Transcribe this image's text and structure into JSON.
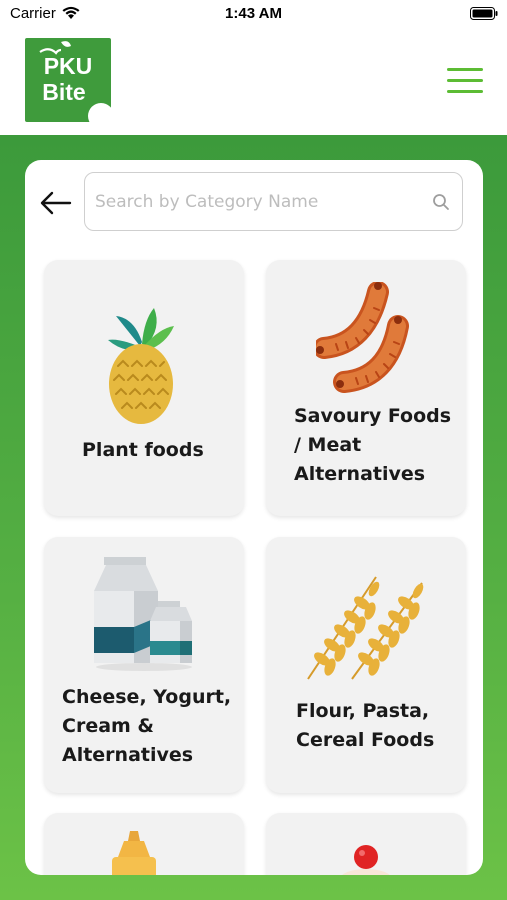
{
  "status_bar": {
    "carrier": "Carrier",
    "time": "1:43 AM"
  },
  "header": {
    "logo_line1": "PKU",
    "logo_line2": "Bite",
    "menu_icon": "hamburger-menu-icon",
    "accent_color": "#5cbc34"
  },
  "search": {
    "placeholder": "Search by Category Name",
    "value": ""
  },
  "categories": [
    {
      "label": "Plant foods",
      "icon": "pineapple-icon"
    },
    {
      "label": "Savoury Foods / Meat Alternatives",
      "icon": "sausage-icon"
    },
    {
      "label": "Cheese, Yogurt, Cream & Alternatives",
      "icon": "milk-carton-icon"
    },
    {
      "label": "Flour, Pasta, Cereal Foods",
      "icon": "wheat-icon"
    },
    {
      "label": "",
      "icon": "bottle-icon"
    },
    {
      "label": "",
      "icon": "cupcake-icon"
    }
  ],
  "colors": {
    "background_green": "#4aa83f",
    "card": "#f2f2f2"
  }
}
